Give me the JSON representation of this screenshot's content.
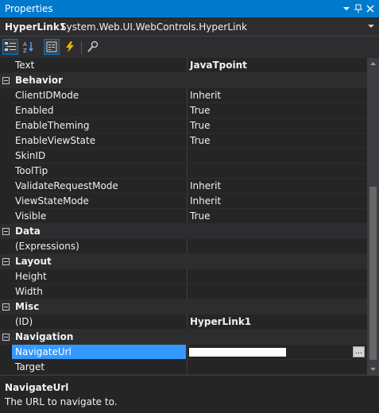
{
  "window": {
    "title": "Properties",
    "icons": [
      "dropdown-arrow-icon",
      "pin-icon",
      "close-icon"
    ]
  },
  "object_selector": {
    "name": "HyperLink1",
    "type": "System.Web.UI.WebControls.HyperLink"
  },
  "toolbar": {
    "buttons": [
      "categorized-icon",
      "alphabetical-icon",
      "properties-icon",
      "events-icon",
      "property-pages-icon"
    ]
  },
  "grid": {
    "text_row": {
      "name": "Text",
      "value": "JavaTpoint"
    },
    "behavior": {
      "label": "Behavior",
      "rows": [
        {
          "name": "ClientIDMode",
          "value": "Inherit"
        },
        {
          "name": "Enabled",
          "value": "True"
        },
        {
          "name": "EnableTheming",
          "value": "True"
        },
        {
          "name": "EnableViewState",
          "value": "True"
        },
        {
          "name": "SkinID",
          "value": ""
        },
        {
          "name": "ToolTip",
          "value": ""
        },
        {
          "name": "ValidateRequestMode",
          "value": "Inherit"
        },
        {
          "name": "ViewStateMode",
          "value": "Inherit"
        },
        {
          "name": "Visible",
          "value": "True"
        }
      ]
    },
    "data": {
      "label": "Data",
      "rows": [
        {
          "name": "(Expressions)",
          "value": ""
        }
      ]
    },
    "layout": {
      "label": "Layout",
      "rows": [
        {
          "name": "Height",
          "value": ""
        },
        {
          "name": "Width",
          "value": ""
        }
      ]
    },
    "misc": {
      "label": "Misc",
      "rows": [
        {
          "name": "(ID)",
          "value": "HyperLink1"
        }
      ]
    },
    "navigation": {
      "label": "Navigation",
      "rows": [
        {
          "name": "NavigateUrl",
          "value": ""
        },
        {
          "name": "Target",
          "value": ""
        }
      ],
      "ellipsis": "..."
    }
  },
  "description": {
    "title": "NavigateUrl",
    "text": "The URL to navigate to."
  }
}
